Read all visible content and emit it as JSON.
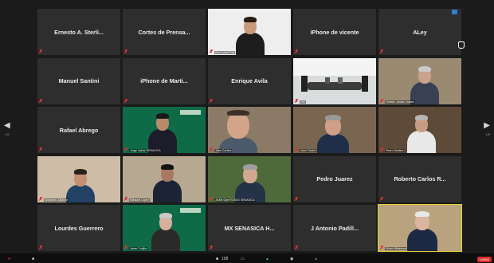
{
  "participants": [
    {
      "name": "Ernesto A. Sterli...",
      "video": false
    },
    {
      "name": "Cortes de Prensa...",
      "video": false
    },
    {
      "name": "",
      "video": true,
      "label": "Ana Luisa Ruiz",
      "scene": "woman-white"
    },
    {
      "name": "iPhone de vicente",
      "video": false
    },
    {
      "name": "ALey",
      "video": false
    },
    {
      "name": "Manuel Santini",
      "video": false
    },
    {
      "name": "iPhone de Marti...",
      "video": false
    },
    {
      "name": "Enrique Avila",
      "video": false
    },
    {
      "name": "",
      "video": true,
      "label": "CM",
      "scene": "meeting-room"
    },
    {
      "name": "",
      "video": true,
      "label": "Octavio Jurado Juarez",
      "scene": "office-man"
    },
    {
      "name": "Rafael Abrego",
      "video": false
    },
    {
      "name": "",
      "video": true,
      "label": "Jorge Jaime SENASICA",
      "scene": "green-man"
    },
    {
      "name": "",
      "video": true,
      "label": "Juan Cortina",
      "scene": "man-closeup"
    },
    {
      "name": "",
      "video": true,
      "label": "Jose Yturbe",
      "scene": "man-glasses"
    },
    {
      "name": "",
      "video": true,
      "label": "Pedro Medina",
      "scene": "man-shelves"
    },
    {
      "name": "",
      "video": true,
      "label": "Alejandro Zaldivar",
      "scene": "man-flowers"
    },
    {
      "name": "",
      "video": true,
      "label": "Baltazar Lopez",
      "scene": "man-window"
    },
    {
      "name": "",
      "video": true,
      "label": "JUAN Gpe.ROSAS SENASICA",
      "scene": "man-outdoor"
    },
    {
      "name": "Pedro Juarez",
      "video": false
    },
    {
      "name": "Roberto Carlos R...",
      "video": false
    },
    {
      "name": "Lourdes Guerrero",
      "video": false
    },
    {
      "name": "",
      "video": true,
      "label": "Javier Trujillo",
      "scene": "green-man2"
    },
    {
      "name": "MX SENASICA H...",
      "video": false
    },
    {
      "name": "J Antonio Padill...",
      "video": false
    },
    {
      "name": "",
      "video": true,
      "label": "Victor Villalobos",
      "scene": "man-books",
      "active": true
    }
  ],
  "navigation": {
    "left_arrow": "◀",
    "right_arrow": "▶",
    "left_pager": "1/5",
    "right_pager": "1/5"
  },
  "toolbar": {
    "participants_count": "108",
    "leave_label": "Leave"
  },
  "colors": {
    "active_speaker": "#e6d42e",
    "muted_mic": "#e0303a",
    "leave": "#d92b2b"
  }
}
